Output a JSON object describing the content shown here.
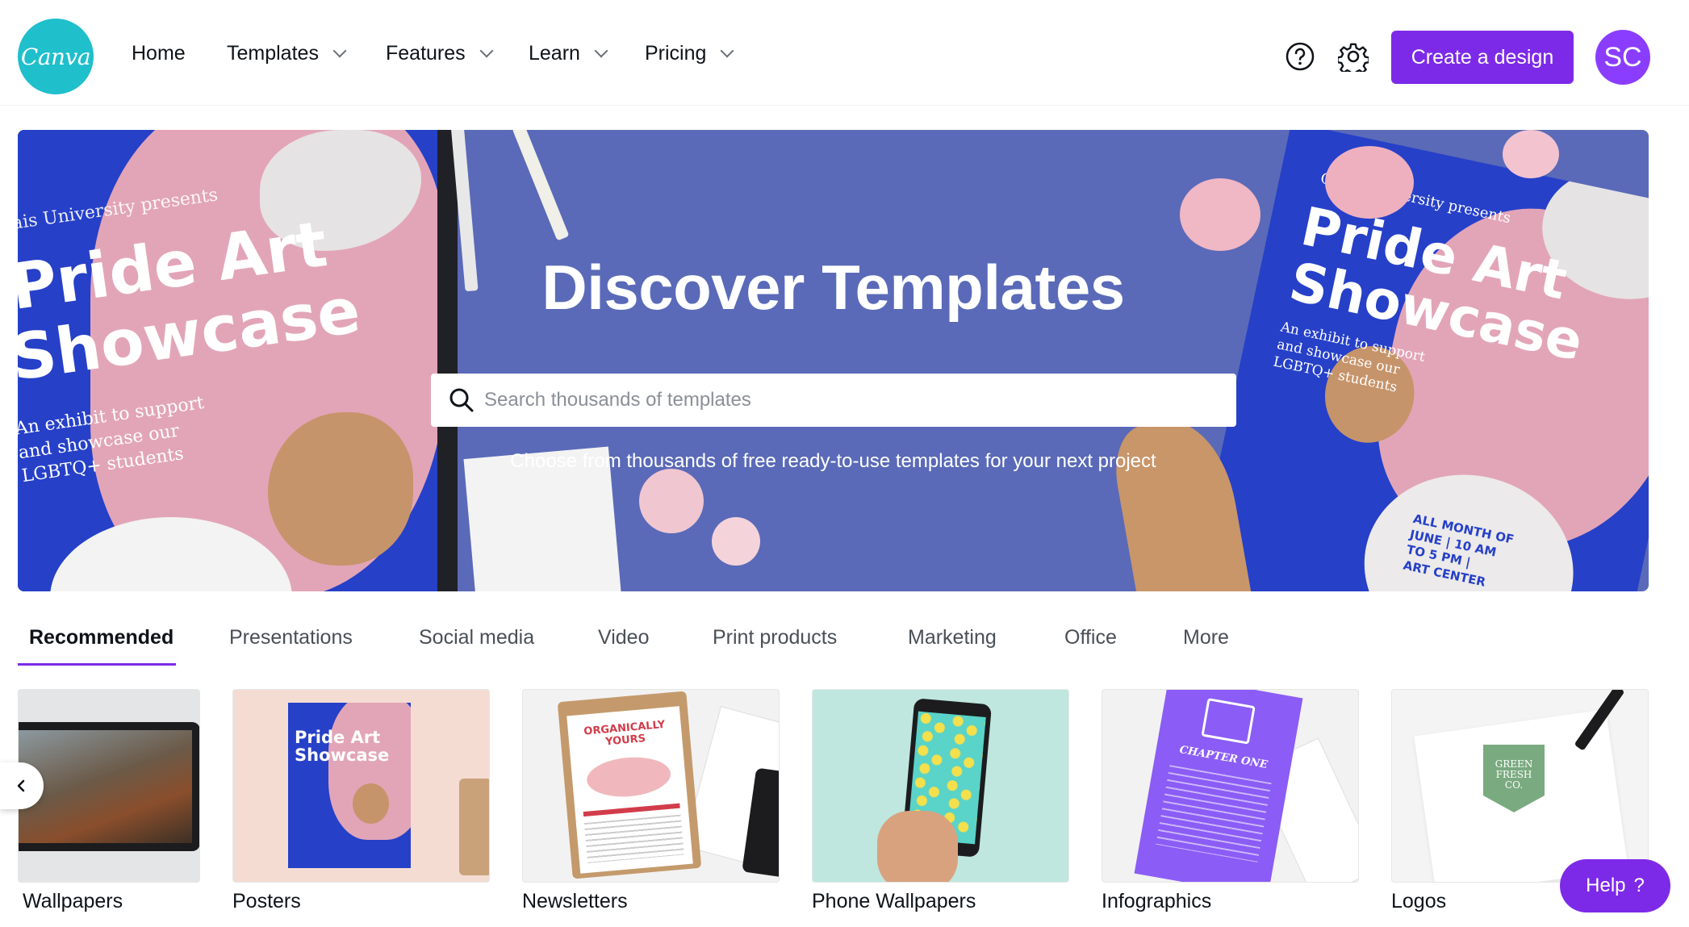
{
  "header": {
    "logo": "Canva",
    "nav": [
      {
        "label": "Home",
        "dropdown": false
      },
      {
        "label": "Templates",
        "dropdown": true
      },
      {
        "label": "Features",
        "dropdown": true
      },
      {
        "label": "Learn",
        "dropdown": true
      },
      {
        "label": "Pricing",
        "dropdown": true
      }
    ],
    "help_icon": "question-circle-icon",
    "settings_icon": "gear-icon",
    "create_label": "Create a design",
    "avatar_initials": "SC"
  },
  "hero": {
    "title": "Discover Templates",
    "search_placeholder": "Search thousands of templates",
    "subtitle": "Choose from thousands of free ready-to-use templates for your next project",
    "left_poster": {
      "presenter": "ais University presents",
      "title_line1": "Pride Art",
      "title_line2": "Showcase",
      "body": [
        "An exhibit to support",
        "and showcase our",
        "LGBTQ+ students"
      ]
    },
    "right_poster": {
      "presenter": "Calais University presents",
      "title_line1": "Pride Art",
      "title_line2": "Showcase",
      "body": [
        "An exhibit to support",
        "and showcase our",
        "LGBTQ+ students"
      ],
      "details": [
        "ALL MONTH OF",
        "JUNE | 10 AM",
        "TO 5 PM |",
        "ART CENTER"
      ]
    }
  },
  "tabs": [
    "Recommended",
    "Presentations",
    "Social media",
    "Video",
    "Print products",
    "Marketing",
    "Office",
    "More"
  ],
  "cards": [
    {
      "label": "Wallpapers"
    },
    {
      "label": "Posters",
      "poster_title": "Pride Art Showcase"
    },
    {
      "label": "Newsletters",
      "headline": "ORGANICALLY YOURS"
    },
    {
      "label": "Phone Wallpapers"
    },
    {
      "label": "Infographics",
      "headline": "CHAPTER ONE"
    },
    {
      "label": "Logos",
      "logo_text": "GREEN FRESH CO."
    }
  ],
  "help_label": "Help",
  "colors": {
    "brand_teal": "#1fbfcc",
    "primary_purple": "#7d2ae8",
    "hero_blue": "#5a6ab8"
  }
}
